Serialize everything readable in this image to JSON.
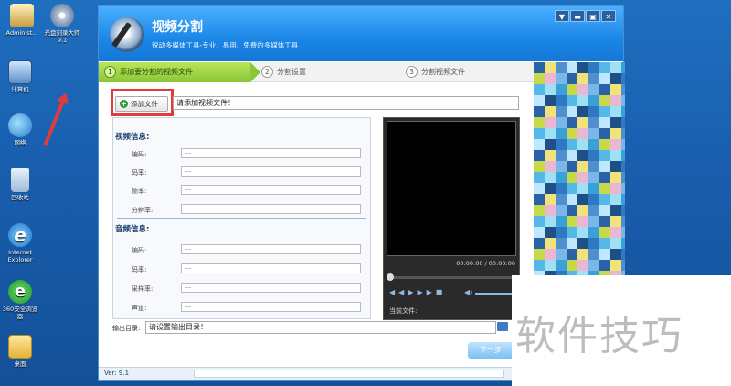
{
  "desktop": {
    "icons": [
      {
        "label": "Administ...",
        "icon": "user-folder-icon"
      },
      {
        "label": "光盘刻录大师 9.1",
        "icon": "disc-burner-icon"
      },
      {
        "label": "计算机",
        "icon": "computer-icon"
      },
      {
        "label": "网络",
        "icon": "network-icon"
      },
      {
        "label": "回收站",
        "icon": "recycle-bin-icon"
      },
      {
        "label": "Internet Explorer",
        "icon": "ie-icon"
      },
      {
        "label": "360安全浏览器",
        "icon": "browser-360-icon"
      },
      {
        "label": "桌面",
        "icon": "folder-icon"
      }
    ]
  },
  "window": {
    "title": "视频分割",
    "subtitle": "锐动多媒体工具-专业、易用、免费的多媒体工具",
    "controls": [
      "▼",
      "▬",
      "▣",
      "✕"
    ]
  },
  "steps": [
    {
      "num": "1",
      "label": "添加要分割的视频文件"
    },
    {
      "num": "2",
      "label": "分割设置"
    },
    {
      "num": "3",
      "label": "分割视频文件"
    }
  ],
  "toolbar": {
    "add_file_label": "添加文件",
    "file_value": "请添加视频文件！"
  },
  "video_info": {
    "heading": "视频信息:",
    "fields": [
      {
        "label": "编码:",
        "value": "---"
      },
      {
        "label": "码率:",
        "value": "---"
      },
      {
        "label": "帧率:",
        "value": "---"
      },
      {
        "label": "分辨率:",
        "value": "---"
      }
    ]
  },
  "audio_info": {
    "heading": "音频信息:",
    "fields": [
      {
        "label": "编码:",
        "value": "---"
      },
      {
        "label": "码率:",
        "value": "---"
      },
      {
        "label": "采样率:",
        "value": "---"
      },
      {
        "label": "声道:",
        "value": "---"
      }
    ]
  },
  "player": {
    "time": "00:00:00 / 00:00:00",
    "current_file_label": "当前文件:",
    "progress": 0
  },
  "output": {
    "label": "输出目录:",
    "value": "请设置输出目录！"
  },
  "next_label": "下一步",
  "status": {
    "version": "Ver: 9.1"
  },
  "watermark": "软件技巧",
  "colors": {
    "accent": "#1a86e6",
    "step_active": "#8bc53a",
    "highlight": "#e23b3b"
  }
}
